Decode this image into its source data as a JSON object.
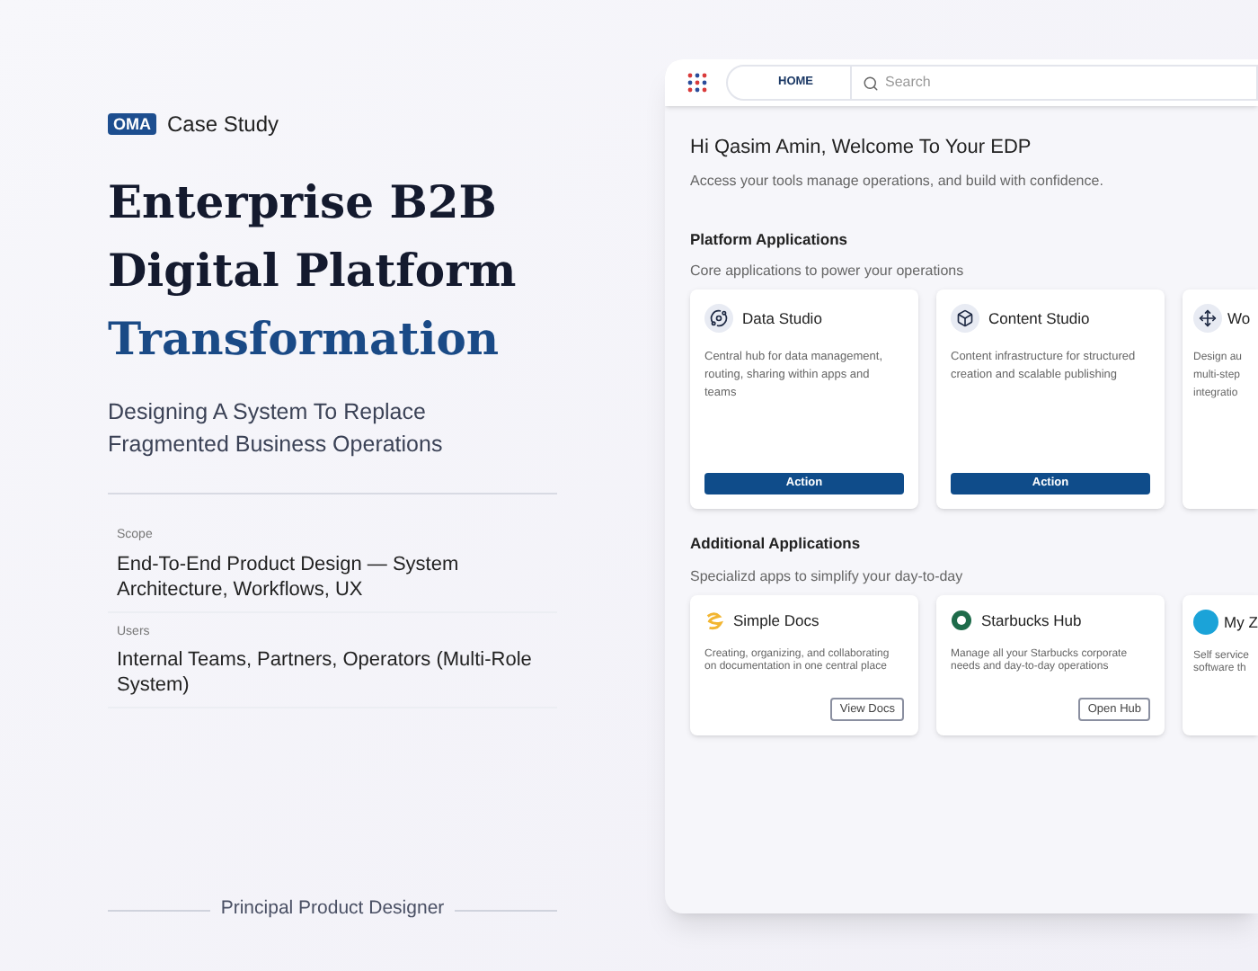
{
  "brand": {
    "logo": "OMA",
    "label": "Case Study"
  },
  "title_lines": [
    {
      "text": "Enterprise B2B",
      "accent": false
    },
    {
      "text": "Digital Platform",
      "accent": false
    },
    {
      "text": "Transformation",
      "accent": true
    }
  ],
  "subtitle": "Designing A System To Replace Fragmented Business Operations",
  "details": [
    {
      "label": "Scope",
      "value": "End-To-End Product Design — System Architecture, Workflows, UX"
    },
    {
      "label": "Users",
      "value": "Internal Teams, Partners, Operators (Multi-Role System)"
    }
  ],
  "footer": "Principal Product Designer",
  "app": {
    "nav": {
      "tab": "HOME",
      "search_placeholder": "Search"
    },
    "greeting": "Hi Qasim Amin, Welcome To Your EDP",
    "tagline": "Access your tools manage operations, and build with confidence.",
    "sections": [
      {
        "kind": "primary",
        "title": "Platform Applications",
        "subtitle": "Core applications to power your operations",
        "cards": [
          {
            "name": "Data Studio",
            "description": "Central hub for data management, routing, sharing within apps and teams",
            "button": "Action"
          },
          {
            "name": "Content Studio",
            "description": "Content infrastructure for structured creation and scalable publishing",
            "button": "Action"
          },
          {
            "name": "Wo",
            "description": "Design au\nmulti-step\nintegratio"
          }
        ]
      },
      {
        "kind": "outline",
        "title": "Additional Applications",
        "subtitle": "Specializd apps to simplify your day-to-day",
        "cards": [
          {
            "name": "Simple Docs",
            "description": "Creating, organizing, and collaborating on documentation in one central place",
            "button": "View Docs"
          },
          {
            "name": "Starbucks Hub",
            "description": "Manage all your Starbucks corporate needs and day-to-day operations",
            "button": "Open Hub"
          },
          {
            "name": "My Z",
            "description": "Self service\nsoftware th"
          }
        ]
      }
    ]
  }
}
